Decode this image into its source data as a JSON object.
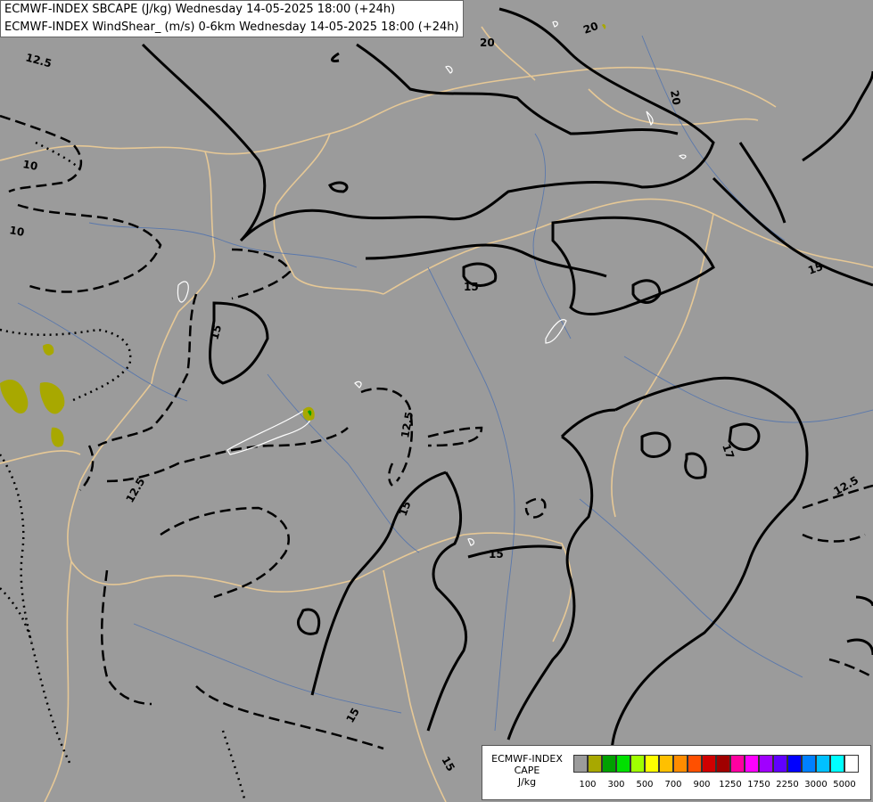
{
  "titles": {
    "line1": "ECMWF-INDEX SBCAPE (J/kg) Wednesday 14-05-2025 18:00 (+24h)",
    "line2": "ECMWF-INDEX WindShear_ (m/s) 0-6km Wednesday 14-05-2025 18:00 (+24h)"
  },
  "legend": {
    "title_lines": [
      "ECMWF-INDEX",
      "CAPE",
      "J/kg"
    ],
    "colors": [
      "#9b9b9b",
      "#a8a800",
      "#00a000",
      "#00e000",
      "#a0ff00",
      "#ffff00",
      "#ffc000",
      "#ff8c00",
      "#ff5000",
      "#d00000",
      "#a00000",
      "#ff00a0",
      "#ff00ff",
      "#a000ff",
      "#6000ff",
      "#0000ff",
      "#0080ff",
      "#00c0ff",
      "#00ffff",
      "#ffffff"
    ],
    "ticks": [
      "100",
      "300",
      "500",
      "700",
      "900",
      "1250",
      "1750",
      "2250",
      "3000",
      "5000"
    ]
  },
  "contour_labels": [
    {
      "text": "12.5"
    },
    {
      "text": "10"
    },
    {
      "text": "10"
    },
    {
      "text": "20"
    },
    {
      "text": "20"
    },
    {
      "text": "20"
    },
    {
      "text": "15"
    },
    {
      "text": "15"
    },
    {
      "text": "15"
    },
    {
      "text": "12.5"
    },
    {
      "text": "15"
    },
    {
      "text": "12.5"
    },
    {
      "text": "15"
    },
    {
      "text": "17"
    },
    {
      "text": "12.5"
    },
    {
      "text": "15"
    },
    {
      "text": "15"
    }
  ]
}
